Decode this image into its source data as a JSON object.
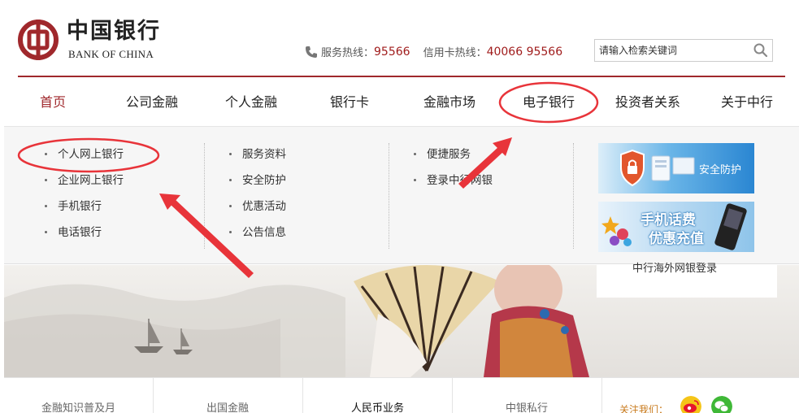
{
  "brand": {
    "name_cn": "中国银行",
    "name_en": "BANK OF CHINA"
  },
  "hotlines": {
    "service_label": "服务热线：",
    "service_number": "95566",
    "card_label": "信用卡热线：",
    "card_number": "40066 95566"
  },
  "search": {
    "placeholder": "请输入检索关键词"
  },
  "nav": {
    "items": [
      "首页",
      "公司金融",
      "个人金融",
      "银行卡",
      "金融市场",
      "电子银行",
      "投资者关系",
      "关于中行"
    ]
  },
  "dropdown": {
    "col1": [
      "个人网上银行",
      "企业网上银行",
      "手机银行",
      "电话银行"
    ],
    "col2": [
      "服务资料",
      "安全防护",
      "优惠活动",
      "公告信息"
    ],
    "col3": [
      "便捷服务",
      "登录中行网银"
    ],
    "promo1_text": "安全防护",
    "promo2_line1": "手机话费",
    "promo2_line2": "优惠充值"
  },
  "login_panel": {
    "text": "中行海外网银登录"
  },
  "bottom": {
    "items": [
      "金融知识普及月",
      "出国金融",
      "人民币业务",
      "中银私行"
    ],
    "follow_label": "关注我们："
  },
  "colors": {
    "brand_red": "#a0282c",
    "annotation_red": "#e8343a",
    "promo_blue": "#2f8fd8"
  }
}
